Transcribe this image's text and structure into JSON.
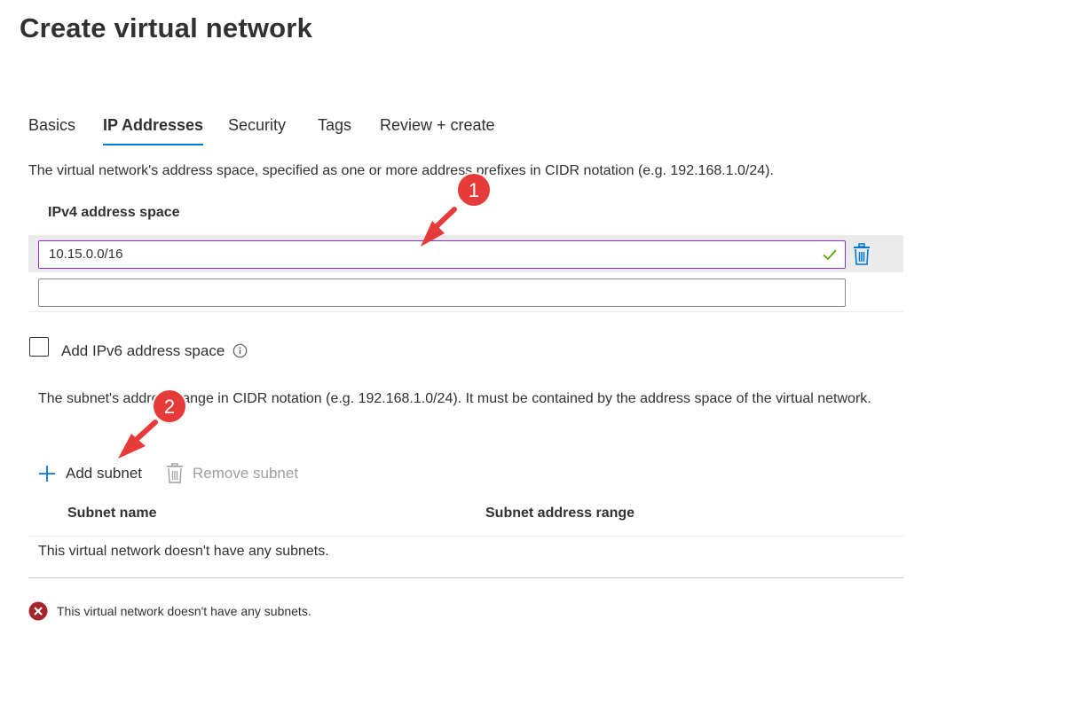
{
  "page": {
    "title": "Create virtual network"
  },
  "tabs": [
    {
      "label": "Basics",
      "active": false
    },
    {
      "label": "IP Addresses",
      "active": true
    },
    {
      "label": "Security",
      "active": false
    },
    {
      "label": "Tags",
      "active": false
    },
    {
      "label": "Review + create",
      "active": false
    }
  ],
  "address_space": {
    "description": "The virtual network's address space, specified as one or more address prefixes in CIDR notation (e.g. 192.168.1.0/24).",
    "column_header": "IPv4 address space",
    "entries": [
      {
        "value": "10.15.0.0/16",
        "valid": true
      },
      {
        "value": "",
        "placeholder": ""
      }
    ]
  },
  "ipv6": {
    "label": "Add IPv6 address space",
    "checked": false
  },
  "subnets": {
    "description": "The subnet's address range in CIDR notation (e.g. 192.168.1.0/24). It must be contained by the address space of the virtual network.",
    "add_label": "Add subnet",
    "remove_label": "Remove subnet",
    "columns": [
      "Subnet name",
      "Subnet address range"
    ],
    "empty_text": "This virtual network doesn't have any subnets."
  },
  "validation": {
    "error_text": "This virtual network doesn't have any subnets."
  },
  "annotations": [
    "1",
    "2"
  ],
  "colors": {
    "accent": "#0078d4",
    "focus_border": "#8a2be2",
    "valid_check": "#57a300",
    "error": "#a4262c",
    "annotation": "#e63b3b"
  }
}
